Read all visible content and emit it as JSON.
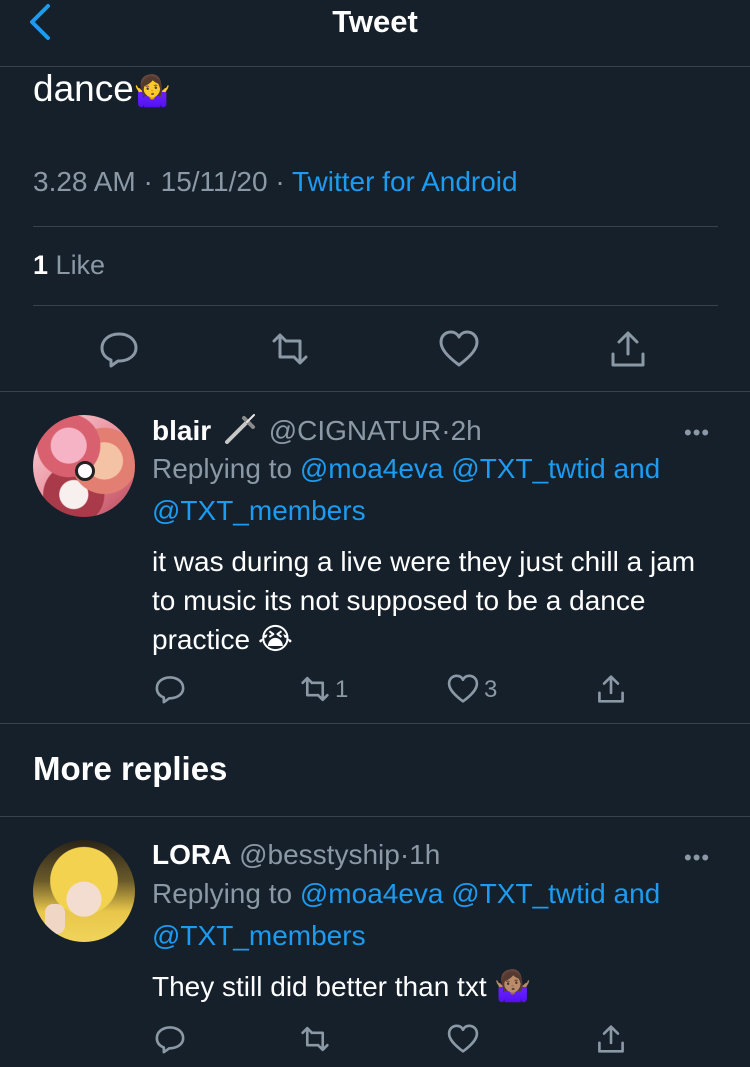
{
  "header": {
    "title": "Tweet"
  },
  "tweet": {
    "text": "dance",
    "emoji": "🤷‍♀️",
    "time": "3.28 AM",
    "date": "15/11/20",
    "source": "Twitter for Android",
    "like_count": "1",
    "like_label": "Like",
    "sep": "·"
  },
  "icons": [
    "back-chevron-icon",
    "reply-icon",
    "retweet-icon",
    "like-icon",
    "share-icon",
    "more-icon",
    "dagger-icon"
  ],
  "replies": [
    {
      "name": "blair",
      "handle": "@CIGNATUR",
      "time": "2h",
      "replying_label": "Replying to",
      "mentions_line1": "@moa4eva @TXT_twtid and",
      "mentions_line2": "@TXT_members",
      "text": "it was during a live were they just chill a jam to music its not supposed to be a dance practice",
      "emoji": "😭",
      "retweets": "1",
      "likes": "3"
    },
    {
      "name": "LORA",
      "handle": "@besstyship",
      "time": "1h",
      "replying_label": "Replying to",
      "mentions_line1": "@moa4eva @TXT_twtid and",
      "mentions_line2": "@TXT_members",
      "text": "They still did better than txt",
      "emoji": "🤷🏽‍♀️"
    }
  ],
  "more_replies": {
    "heading": "More replies"
  },
  "colors": {
    "background": "#15202b",
    "accent": "#1d9bf0",
    "secondary_text": "#8b98a5",
    "divider": "#38444d"
  }
}
